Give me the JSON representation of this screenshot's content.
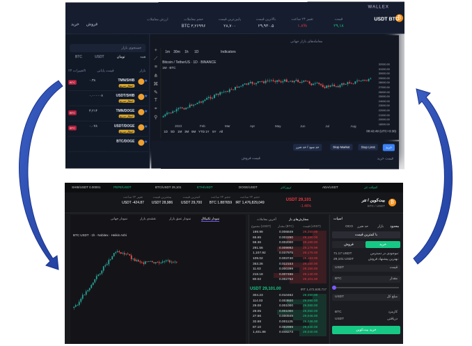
{
  "top_screenshot": {
    "brand": "WALLEX",
    "symbol": "USDT BTC",
    "symbol_sub": "بیت کوین",
    "coin_glyph": "₿",
    "stats": [
      {
        "key": "قیمت",
        "val": "۲۹,۱۸",
        "cls": "grn"
      },
      {
        "key": "تغییر ۲۴ ساعت",
        "val": "۱.۸%",
        "cls": "red"
      },
      {
        "key": "بالاترین قیمت",
        "val": "۲۹,۹۳۰.۵",
        "cls": ""
      },
      {
        "key": "پایین‌ترین قیمت",
        "val": "۲۸,۷۰۰",
        "cls": ""
      },
      {
        "key": "حجم معاملات",
        "val": "BTC ۳,۲۶۹۹۶",
        "cls": ""
      },
      {
        "key": "ارزش معاملات",
        "val": "",
        "cls": ""
      }
    ],
    "left_buttons": {
      "buy": "خرید",
      "sell": "فروش"
    },
    "search_placeholder": "جستجوی بازار",
    "tabs": [
      "همه",
      "تومان",
      "USDT",
      "BTC"
    ],
    "col_headers": [
      "بازار",
      "قیمت پایانی",
      "تغییرات ۲۴h"
    ],
    "pairs": [
      {
        "name": "TMN/SHIB",
        "price": "۰.۳۸",
        "tag": "BTC",
        "sub": "انتقال سریع"
      },
      {
        "name": "USDT/SHIB",
        "price": "۰.۰۰۰۰۰۸",
        "tag": "",
        "sub": "انتقال سریع"
      },
      {
        "name": "TMN/DOGE",
        "price": "۳,۲۱۴",
        "tag": "BTC",
        "sub": "انتقال سریع"
      },
      {
        "name": "USDT/DOGE",
        "price": "۰.۰۷۸",
        "tag": "BTC",
        "sub": "انتقال سریع"
      },
      {
        "name": "BTC/DOGE",
        "price": "",
        "tag": "",
        "sub": ""
      }
    ],
    "chart_tabs": "معامله‌های بازار جهانی",
    "chart_toolbar": [
      "1m",
      "30m",
      "1h",
      "1D",
      "Indicators"
    ],
    "chart_title": "Bitcoin / TetherUS · 1D · BINANCE",
    "chart_ohlc": "1M · BTC",
    "x_labels": [
      "2023",
      "Feb",
      "Mar",
      "Apr",
      "May",
      "Jun",
      "Jul",
      "Aug"
    ],
    "y_labels": [
      "32000.00",
      "31000.00",
      "30000.00",
      "29000.00",
      "28000.00",
      "27000.00",
      "26000.00",
      "25000.00",
      "24000.00",
      "23000.00",
      "22000.00",
      "21000.00",
      "20000.00",
      "18000.00"
    ],
    "range_buttons": [
      "1D",
      "5D",
      "1M",
      "3M",
      "6M",
      "YTD",
      "1Y",
      "5Y",
      "All"
    ],
    "clock": "08:42:49 (UTC+3:30)",
    "order_types": [
      "خرید",
      "Stop Limit",
      "Stop Market",
      "حد سود / حد ضرر"
    ],
    "order_labels": [
      "قیمت خرید",
      "قیمت فروش"
    ]
  },
  "bottom_screenshot": {
    "ticker": [
      "SHIB/USDT 0.00001",
      "PEPE/USDT",
      "BTC/USDT 29,101",
      "ETH/USDT",
      "DOGE/USDT",
      "ترون/تتر",
      "ADA/USDT",
      "کمپکت تتر"
    ],
    "name": "بیت‌کوین / تتر",
    "pair": "BTC / USDT",
    "coin_glyph": "₿",
    "last_price": "USDT 29,101",
    "change": "-1.46%",
    "stats": [
      {
        "key": "حجم ۲۴ ساعت",
        "val": "IRT 1,476,829,049"
      },
      {
        "key": "حجم ۲۴ ساعت",
        "val": "BTC 1.887659"
      },
      {
        "key": "کمترین قیمت",
        "val": "USDT 29,700"
      },
      {
        "key": "بیشترین قیمت",
        "val": "USDT 28,986"
      },
      {
        "key": "تغییر ۲۴ ساعت",
        "val": "USDT -424.87"
      }
    ],
    "chart_tabs": [
      "نمودار تکنیکال",
      "نمودار عمق بازار",
      "نقشه‌ی بازار",
      "نمودار جهانی"
    ],
    "chart_symbol": "BTC USDT · 1h · Nobitex · Heikin Ashi",
    "book_tabs": [
      "سفارش‌های باز",
      "آخرین معاملات"
    ],
    "book_headers": [
      "قیمت (USDT)",
      "مقدار (BTC)",
      "مجموع (USDT)"
    ],
    "asks": [
      {
        "p": "29,250.00",
        "a": "0.006849",
        "t": "199.99"
      },
      {
        "p": "29,180.00",
        "a": "0.002250",
        "t": "65.65"
      },
      {
        "p": "29,180.00",
        "a": "0.002000",
        "t": "58.36"
      },
      {
        "p": "29,179.99",
        "a": "0.009992",
        "t": "291.56"
      },
      {
        "p": "29,175.00",
        "a": "0.037975",
        "t": "1,107.92"
      },
      {
        "p": "29,163.00",
        "a": "0.003740",
        "t": "109.02"
      },
      {
        "p": "29,150.00",
        "a": "0.012153",
        "t": "353.26"
      },
      {
        "p": "29,150.00",
        "a": "0.000399",
        "t": "11.63"
      },
      {
        "p": "29,140.00",
        "a": "0.007496",
        "t": "218.18"
      },
      {
        "p": "29,101.00",
        "a": "0.002752",
        "t": "80.02"
      }
    ],
    "mid_price": "USDT 29,101.00",
    "mid_alt": "IRT 1,472,630,717",
    "bids": [
      {
        "p": "29,090.00",
        "a": "0.010462",
        "t": "304.23"
      },
      {
        "p": "29,090.00",
        "a": "0.003920",
        "t": "114.03"
      },
      {
        "p": "29,080.00",
        "a": "0.001000",
        "t": "29.08"
      },
      {
        "p": "29,050.00",
        "a": "0.001000",
        "t": "29.05"
      },
      {
        "p": "29,046.00",
        "a": "0.000949",
        "t": "27.56"
      },
      {
        "p": "29,046.00",
        "a": "0.001125",
        "t": "32.68"
      },
      {
        "p": "29,040.00",
        "a": "0.002999",
        "t": "87.10"
      },
      {
        "p": "29,040.00",
        "a": "0.048273",
        "t": "1,401.88"
      }
    ],
    "form": {
      "title": "اسپات",
      "tabs": [
        "محدود",
        "بازار",
        "حد ضرر",
        "OCO"
      ],
      "order_type": "با کمترین قیمت",
      "buy": "خرید",
      "sell": "فروش",
      "balance_label": "موجودی در دسترس:",
      "balance_val": "71.17 USDT",
      "best_label": "بهترین پیشنهاد فروش:",
      "best_val": "29,101 USDT",
      "price_label": "قیمت",
      "price_unit": "USDT",
      "amount_label": "مقدار",
      "amount_unit": "BTC",
      "total_label": "مبلغ کل",
      "total_unit": "USDT",
      "fee_label": "کارمزد",
      "fee_unit": "BTC",
      "receive_label": "دریافتی",
      "receive_unit": "USDT",
      "submit": "خرید بیت‌کوین"
    }
  }
}
